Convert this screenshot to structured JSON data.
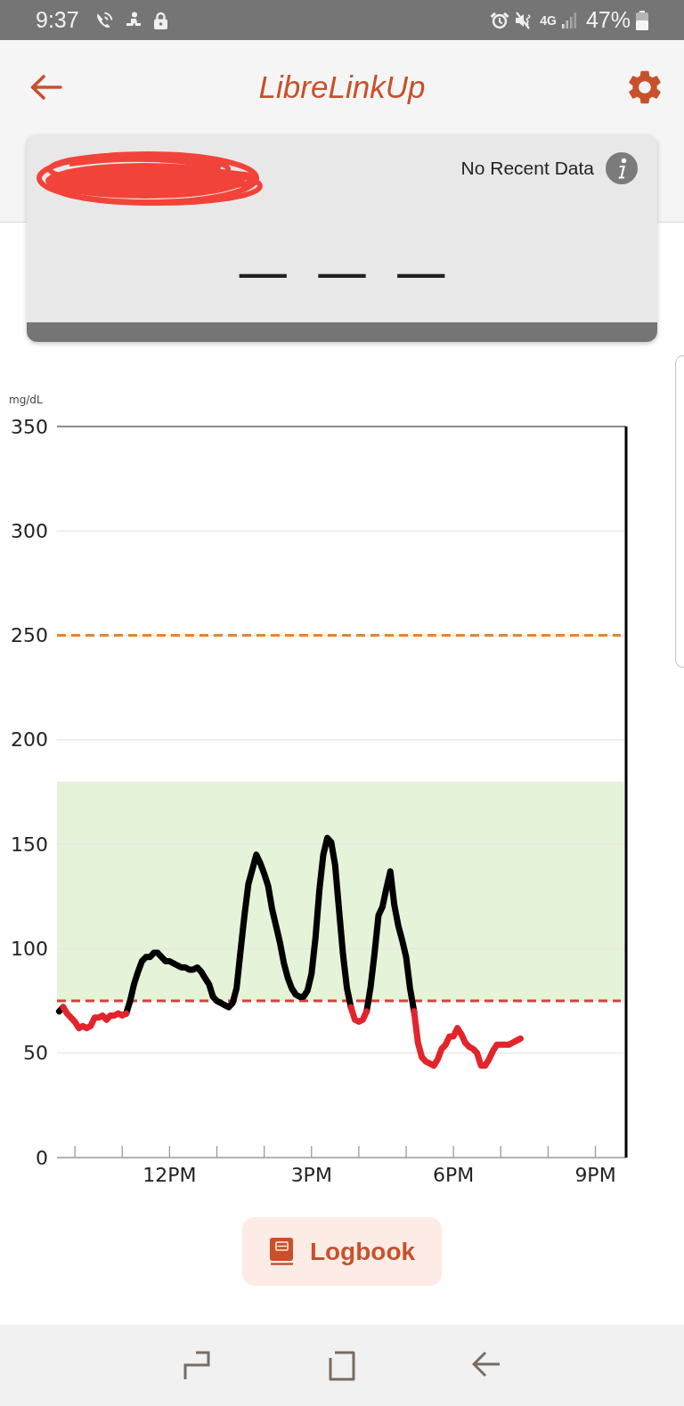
{
  "status_bar": {
    "time": "9:37",
    "network": "4G",
    "battery": "47%"
  },
  "app_bar": {
    "title": "LibreLinkUp"
  },
  "patient_card": {
    "status": "No Recent Data",
    "reading": "— — —"
  },
  "chart": {
    "chart_data": {
      "type": "line",
      "ylabel": "mg/dL",
      "grid": true,
      "categories": [
        null,
        null,
        null,
        null,
        null,
        null,
        null,
        null,
        null,
        null,
        null,
        null,
        null,
        null,
        null,
        null,
        null,
        null,
        null,
        null,
        null,
        null,
        null,
        null,
        null,
        null,
        null,
        null,
        null,
        "12PM",
        null,
        null,
        null,
        null,
        null,
        null,
        null,
        null,
        null,
        null,
        null,
        null,
        null,
        null,
        null,
        null,
        null,
        null,
        null,
        null,
        null,
        null,
        null,
        null,
        null,
        null,
        null,
        null,
        null,
        null,
        null,
        null,
        null,
        null,
        null,
        "3PM",
        null,
        null,
        null,
        null,
        null,
        null,
        null,
        null,
        null,
        null,
        null,
        null,
        null,
        null,
        null,
        null,
        null,
        null,
        null,
        null,
        null,
        null,
        null,
        null,
        null,
        null,
        null,
        null,
        null,
        null,
        null,
        null,
        null,
        null,
        null,
        "6PM",
        null,
        null,
        null,
        null,
        null,
        null,
        null,
        null,
        null,
        null,
        null,
        null,
        null,
        null,
        null,
        null,
        null,
        null,
        null,
        null,
        null,
        null,
        null,
        null,
        null,
        null,
        null,
        null,
        null,
        null,
        null,
        null,
        null,
        null,
        null,
        "9PM",
        null,
        null,
        null,
        null,
        null,
        null
      ],
      "series": [
        {
          "color": "#000000",
          "values": [
            null,
            70,
            72,
            null,
            null,
            null,
            null,
            null,
            null,
            null,
            null,
            null,
            null,
            null,
            null,
            null,
            null,
            null,
            69,
            75,
            83,
            89,
            94,
            96,
            96,
            98,
            98,
            96,
            94,
            94,
            93,
            92,
            91,
            91,
            90,
            90,
            91,
            89,
            86,
            83,
            77,
            75,
            74,
            73,
            72,
            74,
            81,
            99,
            116,
            131,
            138,
            145,
            141,
            136,
            130,
            119,
            111,
            103,
            93,
            86,
            81,
            78,
            77,
            77,
            80,
            88,
            105,
            128,
            145,
            153,
            151,
            140,
            118,
            97,
            81,
            72,
            null,
            null,
            null,
            70,
            82,
            98,
            116,
            120,
            129,
            137,
            121,
            111,
            104,
            96,
            81,
            70,
            null,
            null,
            null,
            null,
            null,
            null,
            null,
            null,
            null,
            null,
            null,
            null,
            null,
            null,
            null,
            null,
            null,
            null,
            null,
            null,
            null,
            null,
            null,
            null,
            null,
            null,
            null,
            null,
            null,
            null,
            null,
            null,
            null,
            null,
            null,
            null,
            null,
            null,
            null,
            null,
            null,
            null,
            null,
            null,
            null,
            null,
            null,
            null,
            null,
            null,
            null,
            null
          ]
        },
        {
          "color": "#e3242b",
          "values": [
            null,
            null,
            72,
            69,
            67,
            65,
            62,
            63,
            62,
            63,
            67,
            67,
            68,
            66,
            68,
            68,
            69,
            68,
            69,
            null,
            null,
            null,
            null,
            null,
            null,
            null,
            null,
            null,
            null,
            null,
            null,
            null,
            null,
            null,
            null,
            null,
            null,
            null,
            null,
            null,
            null,
            null,
            null,
            null,
            null,
            null,
            null,
            null,
            null,
            null,
            null,
            null,
            null,
            null,
            null,
            null,
            null,
            null,
            null,
            null,
            null,
            null,
            null,
            null,
            null,
            null,
            null,
            null,
            null,
            null,
            null,
            null,
            null,
            null,
            null,
            72,
            66,
            65,
            66,
            70,
            null,
            null,
            null,
            null,
            null,
            null,
            null,
            null,
            null,
            null,
            null,
            70,
            55,
            48,
            46,
            45,
            44,
            47,
            52,
            54,
            58,
            58,
            62,
            59,
            55,
            53,
            52,
            50,
            44,
            44,
            47,
            51,
            54,
            54,
            54,
            54,
            55,
            56,
            57,
            null,
            null,
            null,
            null,
            null,
            null,
            null,
            null,
            null,
            null,
            null,
            null,
            null,
            null,
            null,
            null,
            null,
            null,
            null,
            null,
            null,
            null,
            null,
            null,
            null
          ]
        }
      ],
      "ylim": [
        0,
        350
      ],
      "yticks": [
        0,
        50,
        100,
        150,
        200,
        250,
        300,
        350
      ],
      "bands": [
        {
          "axis": "y",
          "from": 75,
          "to": 180,
          "color": "#e5f3d8"
        }
      ],
      "ref_lines": [
        {
          "axis": "y",
          "value": 250,
          "color": "#e6832f"
        },
        {
          "axis": "y",
          "value": 75,
          "color": "#d1443a"
        }
      ]
    }
  },
  "logbook_button": {
    "label": "Logbook"
  }
}
